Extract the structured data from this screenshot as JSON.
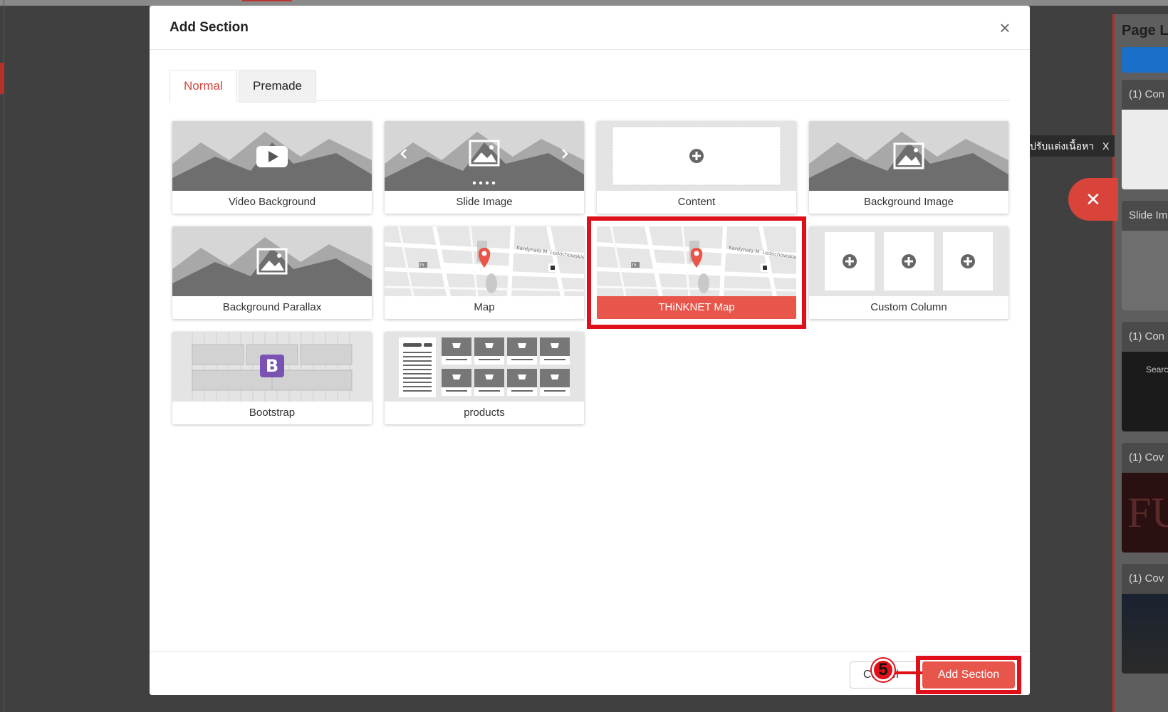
{
  "background": {
    "page_layout_title": "Page Lo",
    "cards": [
      {
        "head": "(1) Con"
      },
      {
        "head": "Slide Im"
      },
      {
        "head": "(1) Con",
        "body": "Searc"
      },
      {
        "head": "(1) Cov",
        "body": "FU"
      },
      {
        "head": "(1) Cov"
      }
    ],
    "tooltip": "ปรับแต่งเนื้อหา",
    "tooltip_close": "X",
    "fab_icon": "✕"
  },
  "modal": {
    "title": "Add Section",
    "close_icon": "×",
    "tabs": [
      {
        "label": "Normal",
        "active": true
      },
      {
        "label": "Premade",
        "active": false
      }
    ],
    "items": [
      {
        "label": "Video Background",
        "icon": "video-play-icon"
      },
      {
        "label": "Slide Image",
        "icon": "slide-image-icon"
      },
      {
        "label": "Content",
        "icon": "plus-circle-icon"
      },
      {
        "label": "Background Image",
        "icon": "image-icon"
      },
      {
        "label": "Background Parallax",
        "icon": "image-icon"
      },
      {
        "label": "Map",
        "icon": "map-pin-icon"
      },
      {
        "label": "THiNKNET Map",
        "icon": "map-pin-icon",
        "selected": true
      },
      {
        "label": "Custom Column",
        "icon": "plus-circle-icon"
      },
      {
        "label": "Bootstrap",
        "icon": "bootstrap-icon",
        "glyph": "B"
      },
      {
        "label": "products",
        "icon": "cart-icon"
      }
    ],
    "map_text": {
      "street1": "Kardynała M. Ledóchowskiego",
      "street2": "Pańska",
      "street3": "Parzyancka",
      "badge": "25"
    },
    "footer": {
      "cancel_label": "Cancel",
      "add_label": "Add Section",
      "step_number": "5"
    }
  },
  "colors": {
    "accent": "#e8564b",
    "highlight": "#e0101a",
    "tab_active": "#d9443a"
  }
}
